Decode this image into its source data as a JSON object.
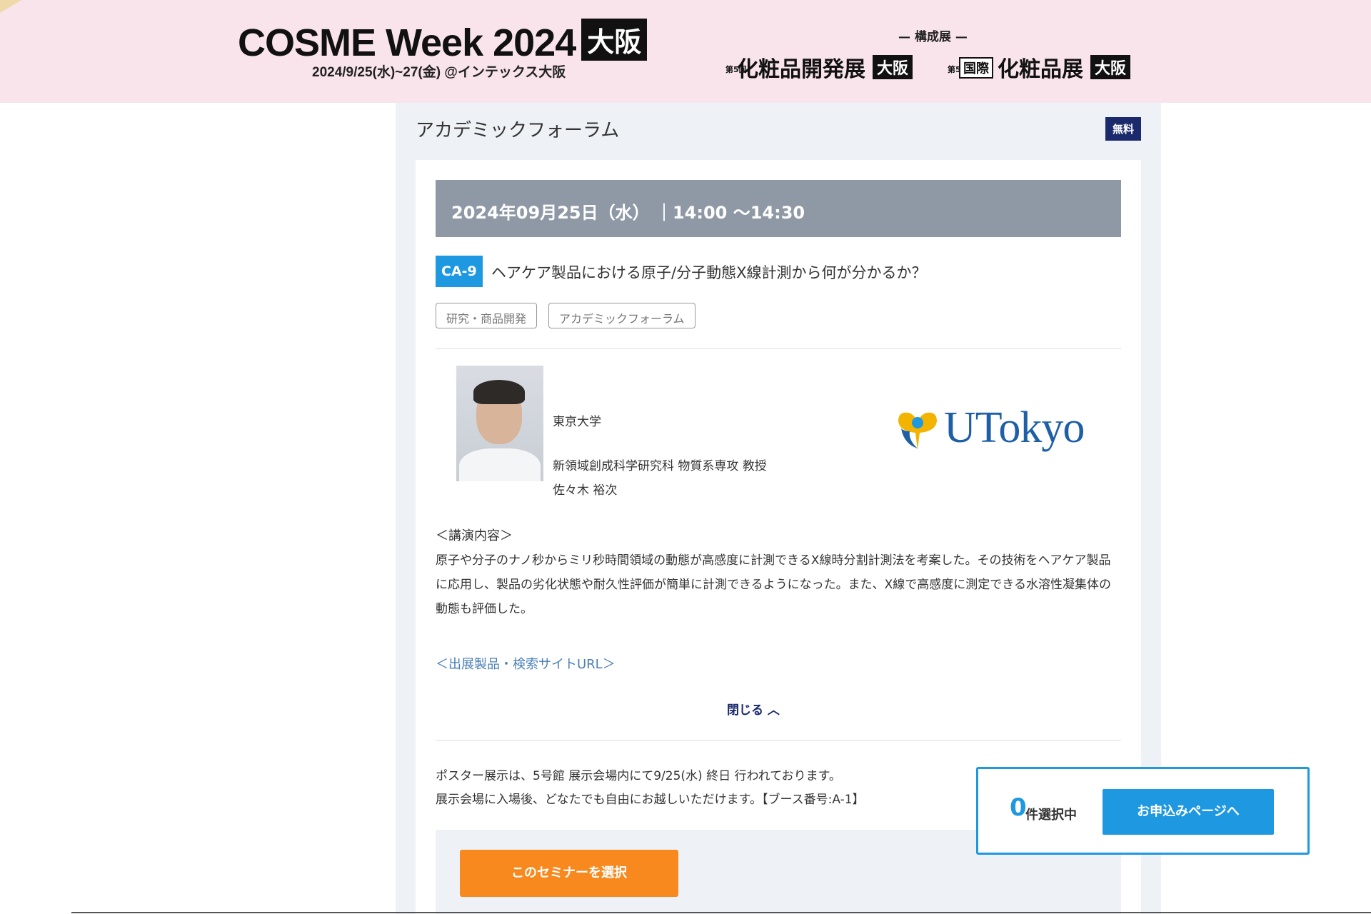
{
  "header": {
    "brand_title": "COSME Week 2024",
    "brand_city": "大阪",
    "brand_dates": "2024/9/25(水)~27(金) @インテックス大阪",
    "sub_caption": "— 構成展 —",
    "show1_edition": "第5回",
    "show1_name": "化粧品開発展",
    "show1_city": "大阪",
    "show2_edition": "第5回",
    "show2_intl": "国際",
    "show2_name": "化粧品展",
    "show2_city": "大阪"
  },
  "panel": {
    "title": "アカデミックフォーラム",
    "badge": "無料"
  },
  "seminar": {
    "date_time": "2024年09月25日（水） ｜14:00 ～14:30",
    "code": "CA-9",
    "title": "ヘアケア製品における原子/分子動態X線計測から何が分かるか？",
    "tags": [
      "研究・商品開発",
      "アカデミックフォーラム"
    ]
  },
  "speaker": {
    "organization": "東京大学",
    "position": "新領域創成科学研究科 物質系専攻 教授",
    "name": "佐々木 裕次",
    "logo_text": "UTokyo"
  },
  "content": {
    "heading": "＜講演内容＞",
    "body": "原子や分子のナノ秒からミリ秒時間領域の動態が高感度に計測できるX線時分割計測法を考案した。その技術をヘアケア製品に応用し、製品の劣化状態や耐久性評価が簡単に計測できるようになった。また、X線で高感度に測定できる水溶性凝集体の動態も評価した。",
    "url_link": "＜出展製品・検索サイトURL＞",
    "close_label": "閉じる ︿"
  },
  "poster": {
    "line1": "ポスター展示は、5号館 展示会場内にて9/25(水) 終日 行われております。",
    "line2": "展示会場に入場後、どなたでも自由にお越しいただけます。【ブース番号:A-1】"
  },
  "select_button": "このセミナーを選択",
  "selection": {
    "count": "0",
    "count_label": "件選択中",
    "apply_button": "お申込みページへ"
  },
  "colors": {
    "banner_bg": "#f8e4ea",
    "accent_blue": "#1e98e0",
    "navy": "#1a2a6c",
    "orange": "#f7891f",
    "date_bar": "#8f99a6"
  }
}
